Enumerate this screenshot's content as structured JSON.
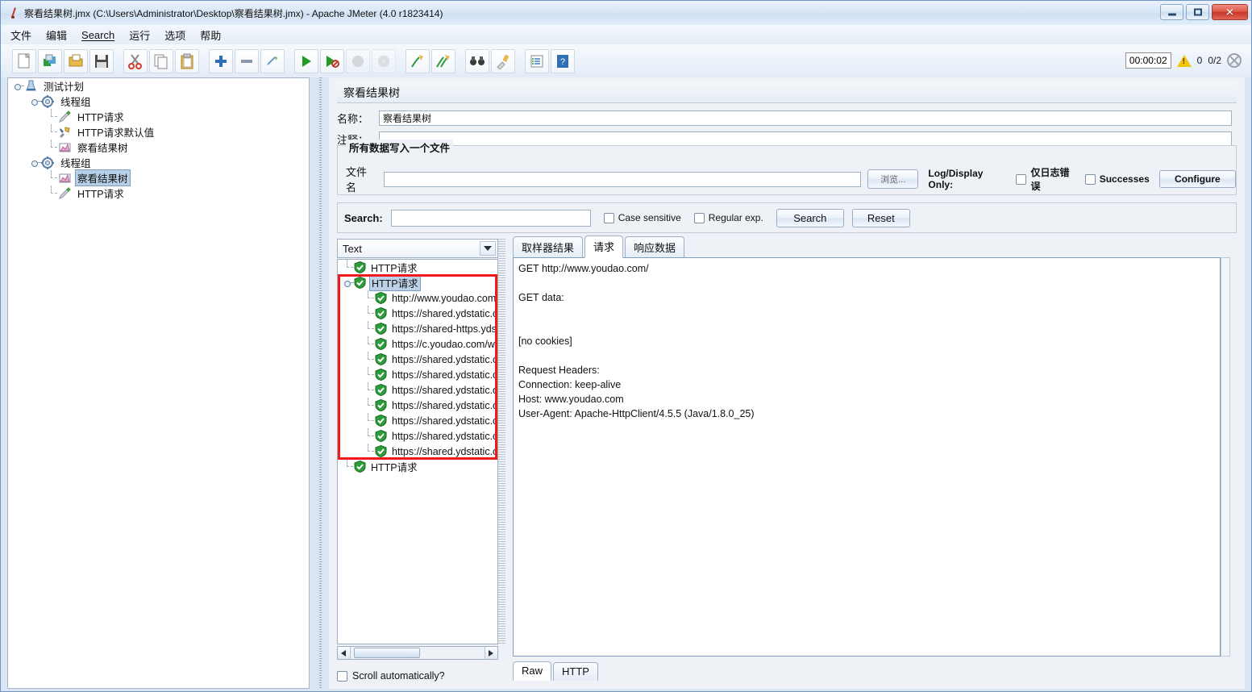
{
  "window": {
    "title": "察看结果树.jmx (C:\\Users\\Administrator\\Desktop\\察看结果树.jmx) - Apache JMeter (4.0 r1823414)",
    "app_icon": "jmeter-feather-icon",
    "minimize_label": "",
    "maximize_label": "",
    "close_label": "✕"
  },
  "menu": {
    "items": [
      {
        "label": "文件"
      },
      {
        "label": "编辑"
      },
      {
        "label": "Search"
      },
      {
        "label": "运行"
      },
      {
        "label": "选项"
      },
      {
        "label": "帮助"
      }
    ]
  },
  "toolbar": {
    "buttons": [
      {
        "name": "new-icon",
        "tip": "New"
      },
      {
        "name": "templates-icon",
        "tip": "Templates"
      },
      {
        "name": "open-icon",
        "tip": "Open"
      },
      {
        "name": "save-icon",
        "tip": "Save"
      },
      {
        "name": "cut-icon",
        "tip": "Cut"
      },
      {
        "name": "copy-icon",
        "tip": "Copy"
      },
      {
        "name": "paste-icon",
        "tip": "Paste"
      },
      {
        "name": "expand-all-icon",
        "tip": "Expand All"
      },
      {
        "name": "collapse-all-icon",
        "tip": "Collapse All"
      },
      {
        "name": "toggle-icon",
        "tip": "Toggle"
      },
      {
        "name": "start-icon",
        "tip": "Start"
      },
      {
        "name": "start-no-pause-icon",
        "tip": "Start no pauses"
      },
      {
        "name": "stop-icon",
        "tip": "Stop"
      },
      {
        "name": "shutdown-icon",
        "tip": "Shutdown"
      },
      {
        "name": "clear-icon",
        "tip": "Clear"
      },
      {
        "name": "clear-all-icon",
        "tip": "Clear All"
      },
      {
        "name": "search-binoculars-icon",
        "tip": "Search"
      },
      {
        "name": "search-reset-icon",
        "tip": "Reset Search"
      },
      {
        "name": "function-helper-icon",
        "tip": "Function Helper Dialog"
      },
      {
        "name": "help-icon",
        "tip": "Help"
      }
    ],
    "status": {
      "elapsed": "00:00:02",
      "warning_count": "0",
      "threads": "0/2"
    }
  },
  "test_plan_tree": {
    "nodes": [
      {
        "label": "测试计划",
        "depth": 0,
        "icon": "test-plan-icon",
        "expander": true,
        "selected": false
      },
      {
        "label": "线程组",
        "depth": 1,
        "icon": "thread-group-icon",
        "expander": true,
        "selected": false
      },
      {
        "label": "HTTP请求",
        "depth": 2,
        "icon": "http-sampler-icon",
        "expander": false,
        "selected": false
      },
      {
        "label": "HTTP请求默认值",
        "depth": 2,
        "icon": "http-defaults-icon",
        "expander": false,
        "selected": false
      },
      {
        "label": "察看结果树",
        "depth": 2,
        "icon": "view-results-tree-icon",
        "expander": false,
        "selected": false
      },
      {
        "label": "线程组",
        "depth": 1,
        "icon": "thread-group-icon",
        "expander": true,
        "selected": false
      },
      {
        "label": "察看结果树",
        "depth": 2,
        "icon": "view-results-tree-icon",
        "expander": false,
        "selected": true
      },
      {
        "label": "HTTP请求",
        "depth": 2,
        "icon": "http-sampler-icon",
        "expander": false,
        "selected": false
      }
    ]
  },
  "panel": {
    "title": "察看结果树",
    "name_label": "名称：",
    "name_value": "察看结果树",
    "comment_label": "注释：",
    "comment_value": "",
    "group_title": "所有数据写入一个文件",
    "filename_label": "文件名",
    "filename_value": "",
    "browse_button": "浏览...",
    "log_display_label": "Log/Display Only:",
    "errors_only_label": "仅日志错误",
    "successes_label": "Successes",
    "configure_button": "Configure"
  },
  "search": {
    "label": "Search:",
    "value": "",
    "case_sensitive_label": "Case sensitive",
    "regular_exp_label": "Regular exp.",
    "search_button": "Search",
    "reset_button": "Reset"
  },
  "results": {
    "renderer_selected": "Text",
    "scroll_auto_label": "Scroll automatically?",
    "nodes": [
      {
        "label": "HTTP请求",
        "depth": 0,
        "selected": false,
        "expander": false,
        "boxed": false
      },
      {
        "label": "HTTP请求",
        "depth": 0,
        "selected": true,
        "expander": true,
        "boxed": true
      },
      {
        "label": "http://www.youdao.com/",
        "depth": 1,
        "selected": false,
        "expander": false,
        "boxed": true
      },
      {
        "label": "https://shared.ydstatic.c",
        "depth": 1,
        "selected": false,
        "expander": false,
        "boxed": true
      },
      {
        "label": "https://shared-https.ydst",
        "depth": 1,
        "selected": false,
        "expander": false,
        "boxed": true
      },
      {
        "label": "https://c.youdao.com/ww",
        "depth": 1,
        "selected": false,
        "expander": false,
        "boxed": true
      },
      {
        "label": "https://shared.ydstatic.c",
        "depth": 1,
        "selected": false,
        "expander": false,
        "boxed": true
      },
      {
        "label": "https://shared.ydstatic.c",
        "depth": 1,
        "selected": false,
        "expander": false,
        "boxed": true
      },
      {
        "label": "https://shared.ydstatic.c",
        "depth": 1,
        "selected": false,
        "expander": false,
        "boxed": true
      },
      {
        "label": "https://shared.ydstatic.c",
        "depth": 1,
        "selected": false,
        "expander": false,
        "boxed": true
      },
      {
        "label": "https://shared.ydstatic.c",
        "depth": 1,
        "selected": false,
        "expander": false,
        "boxed": true
      },
      {
        "label": "https://shared.ydstatic.c",
        "depth": 1,
        "selected": false,
        "expander": false,
        "boxed": true
      },
      {
        "label": "https://shared.ydstatic.c",
        "depth": 1,
        "selected": false,
        "expander": false,
        "boxed": true
      },
      {
        "label": "HTTP请求",
        "depth": 0,
        "selected": false,
        "expander": false,
        "boxed": false
      }
    ]
  },
  "detail": {
    "tabs": [
      {
        "label": "取样器结果",
        "active": false
      },
      {
        "label": "请求",
        "active": true
      },
      {
        "label": "响应数据",
        "active": false
      }
    ],
    "content": "GET http://www.youdao.com/\n\nGET data:\n\n\n[no cookies]\n\nRequest Headers:\nConnection: keep-alive\nHost: www.youdao.com\nUser-Agent: Apache-HttpClient/4.5.5 (Java/1.8.0_25)",
    "bottom_tabs": [
      {
        "label": "Raw",
        "active": true
      },
      {
        "label": "HTTP",
        "active": false
      }
    ]
  },
  "colors": {
    "accent_blue": "#b8cfe8",
    "annotation_red": "#f01a1a",
    "success_green": "#2e9b3c",
    "titlebar": "#d9e7f7"
  }
}
